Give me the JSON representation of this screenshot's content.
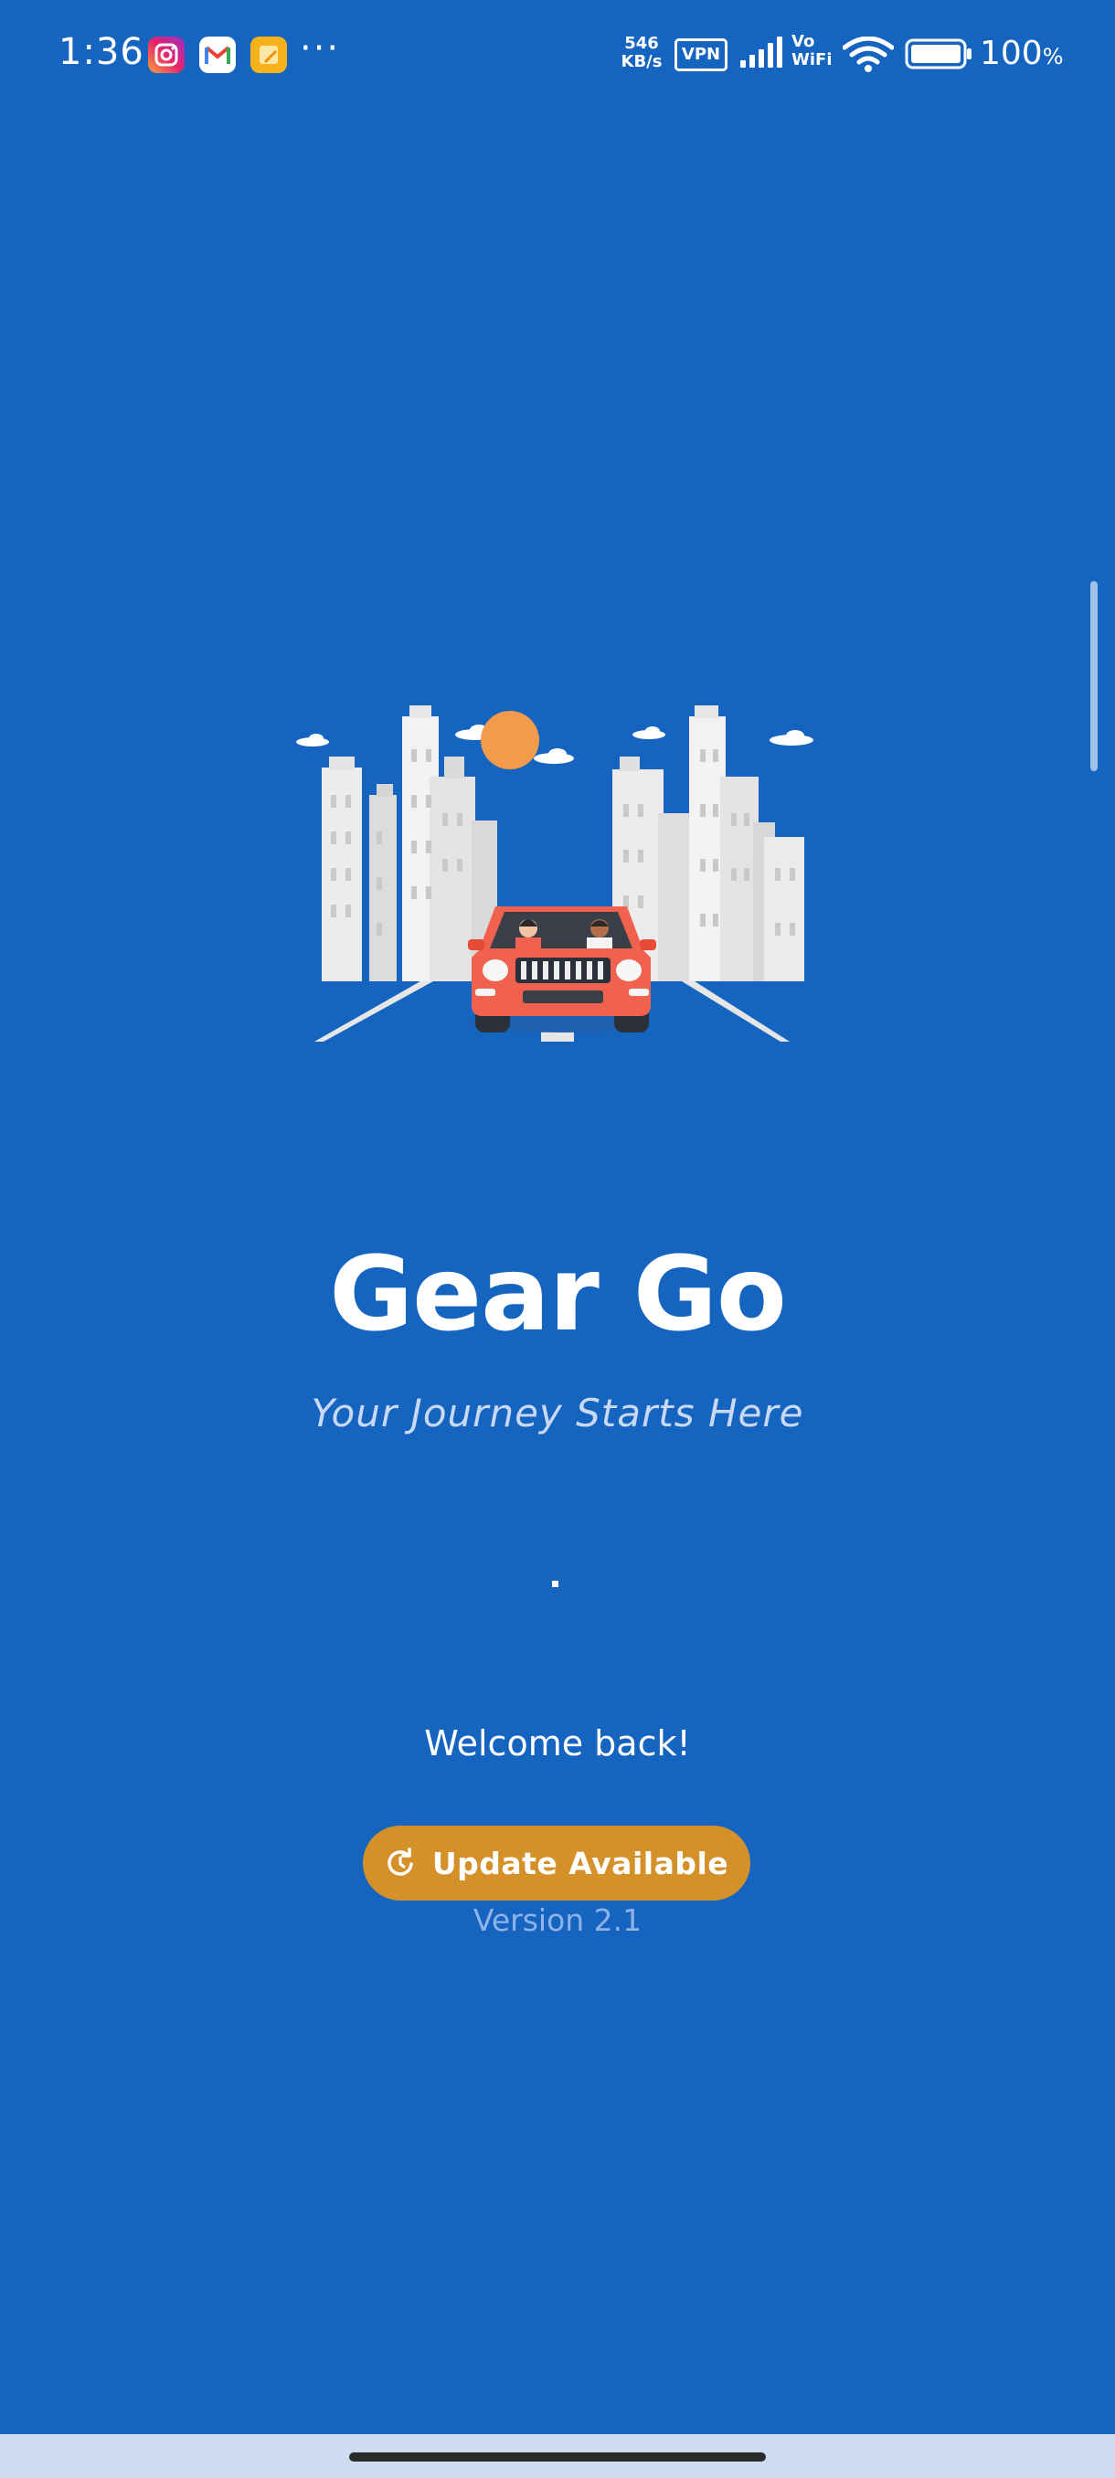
{
  "status_bar": {
    "time": "1:36",
    "dots": "···",
    "net_speed_value": "546",
    "net_speed_unit": "KB/s",
    "vpn": "VPN",
    "vowifi_top": "Vo",
    "vowifi_bottom": "WiFi",
    "battery_percent": "100",
    "battery_unit": "%",
    "app_icons": [
      "instagram-icon",
      "gmail-icon",
      "notes-icon"
    ]
  },
  "splash": {
    "title": "Gear Go",
    "tagline": "Your Journey Starts Here",
    "welcome": "Welcome back!",
    "update_button_label": "Update Available",
    "version": "Version 2.1"
  },
  "colors": {
    "background": "#1565C0",
    "update_button": "#D4912A",
    "car": "#F0624D",
    "sun": "#F39A4B"
  }
}
